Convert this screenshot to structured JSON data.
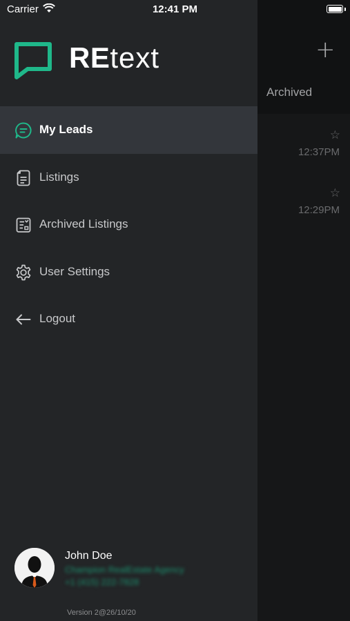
{
  "status_bar": {
    "carrier": "Carrier",
    "time": "12:41 PM"
  },
  "background_screen": {
    "add_icon": "plus-icon",
    "tab_label": "Archived",
    "rows": [
      {
        "star_icon": "star-outline-icon",
        "time": "12:37PM"
      },
      {
        "star_icon": "star-outline-icon",
        "time": "12:29PM"
      }
    ]
  },
  "brand": {
    "logo_icon": "chat-bubble-logo",
    "name_bold": "RE",
    "name_rest": "text"
  },
  "menu": {
    "items": [
      {
        "label": "My Leads",
        "icon": "chat-icon",
        "active": true
      },
      {
        "label": "Listings",
        "icon": "document-icon",
        "active": false
      },
      {
        "label": "Archived Listings",
        "icon": "clipboard-icon",
        "active": false
      },
      {
        "label": "User Settings",
        "icon": "gear-icon",
        "active": false
      },
      {
        "label": "Logout",
        "icon": "arrow-left-icon",
        "active": false
      }
    ]
  },
  "user": {
    "name": "John Doe",
    "agency": "Champion RealEstate Agency",
    "phone": "+1 (415) 222-7828"
  },
  "version": "Version 2@26/10/20",
  "colors": {
    "accent": "#1fb88a",
    "drawer_bg": "#232527",
    "active_item_bg": "#33363b",
    "background_screen": "#161718"
  }
}
